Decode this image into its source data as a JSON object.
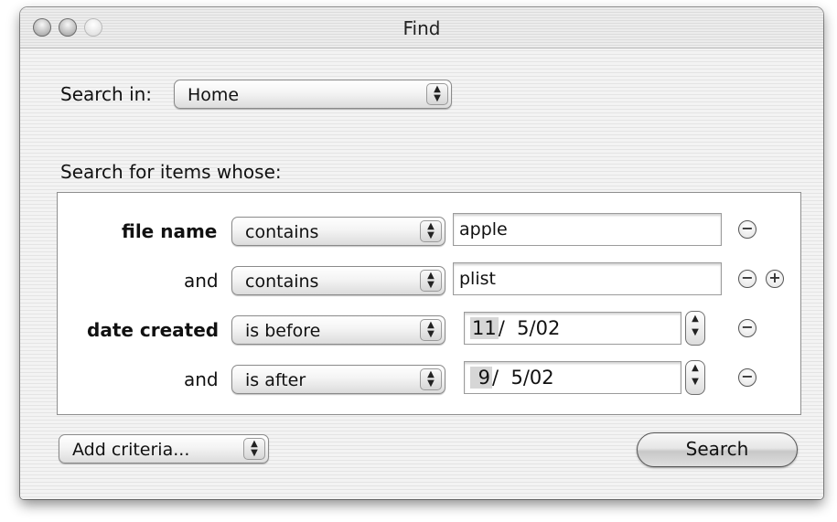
{
  "window": {
    "title": "Find"
  },
  "search_in": {
    "label": "Search in:",
    "value": "Home"
  },
  "criteria_heading": "Search for items whose:",
  "rows": [
    {
      "attribute": "file name",
      "operator": "contains",
      "value": "apple"
    },
    {
      "attribute": "and",
      "operator": "contains",
      "value": "plist"
    },
    {
      "attribute": "date created",
      "operator": "is before",
      "month": "11",
      "rest": "/  5/02"
    },
    {
      "attribute": "and",
      "operator": "is after",
      "month": " 9",
      "rest": "/  5/02"
    }
  ],
  "add_criteria": {
    "value": "Add criteria..."
  },
  "search_button": {
    "label": "Search"
  },
  "icons": {
    "popup_arrows": "▲▼",
    "stepper_arrows": "▲▼",
    "remove": "−",
    "add": "+"
  }
}
